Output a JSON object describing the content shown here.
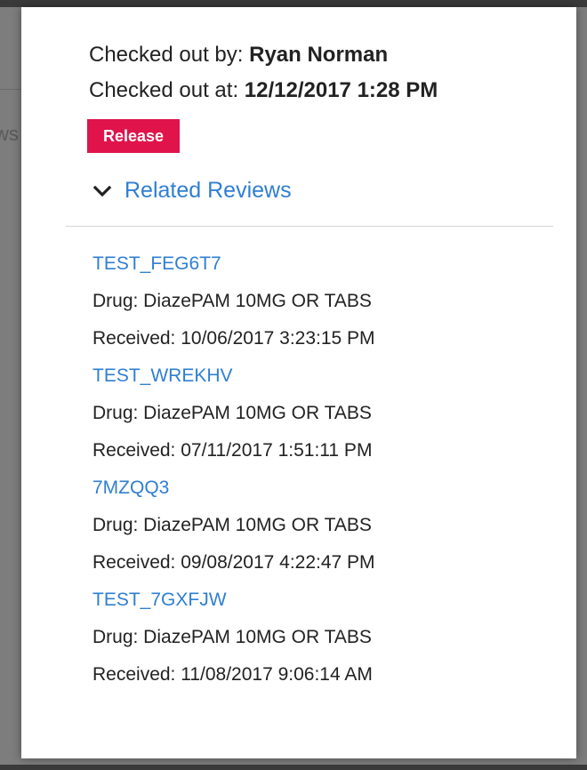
{
  "background": {
    "partial_text": "ws"
  },
  "checkout": {
    "by_label": "Checked out by:",
    "by_value": "Ryan Norman",
    "at_label": "Checked out at:",
    "at_value": "12/12/2017 1:28 PM"
  },
  "release_button": {
    "label": "Release",
    "color": "#e0134a"
  },
  "related_reviews": {
    "toggle_label": "Related Reviews",
    "icon": "chevron-down-icon",
    "link_color": "#2f7fd1",
    "items": [
      {
        "id": "TEST_FEG6T7",
        "drug": "Drug: DiazePAM 10MG OR TABS",
        "received": "Received: 10/06/2017 3:23:15 PM"
      },
      {
        "id": "TEST_WREKHV",
        "drug": "Drug: DiazePAM 10MG OR TABS",
        "received": "Received: 07/11/2017 1:51:11 PM"
      },
      {
        "id": "7MZQQ3",
        "drug": "Drug: DiazePAM 10MG OR TABS",
        "received": "Received: 09/08/2017 4:22:47 PM"
      },
      {
        "id": "TEST_7GXFJW",
        "drug": "Drug: DiazePAM 10MG OR TABS",
        "received": "Received: 11/08/2017 9:06:14 AM"
      }
    ]
  }
}
